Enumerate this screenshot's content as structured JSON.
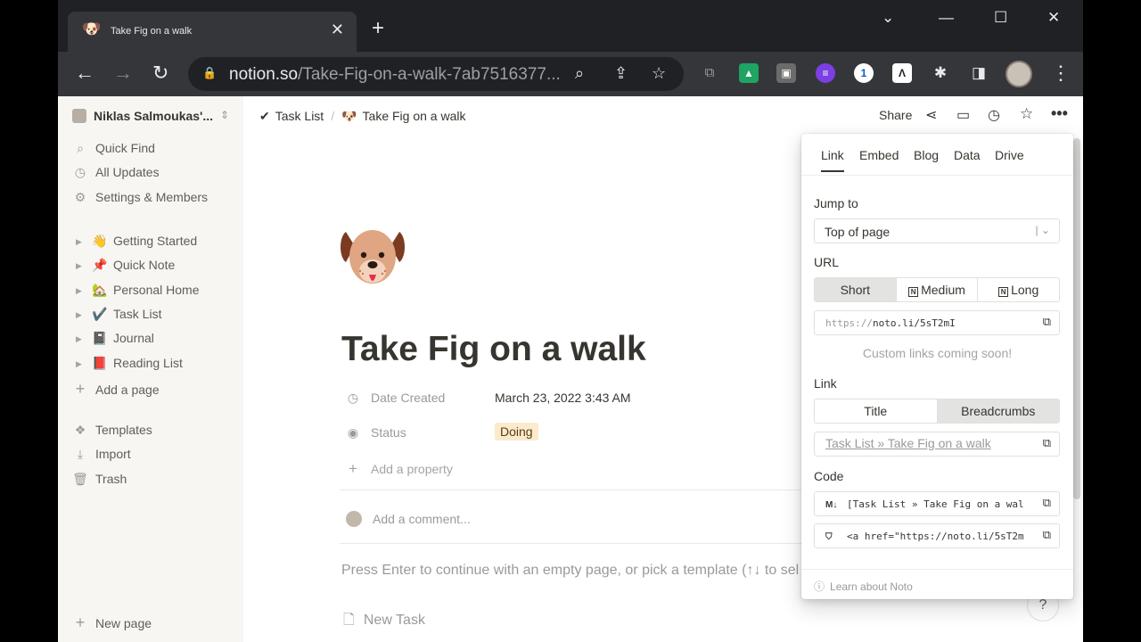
{
  "browser": {
    "tab_title": "Take Fig on a walk",
    "tab_favicon": "🐶",
    "url_domain": "notion.so",
    "url_rest": "/Take-Fig-on-a-walk-7ab7516377..."
  },
  "sidebar": {
    "workspace": "Niklas Salmoukas'...",
    "actions": [
      {
        "label": "Quick Find",
        "icon": "⌕"
      },
      {
        "label": "All Updates",
        "icon": "◷"
      },
      {
        "label": "Settings & Members",
        "icon": "⚙"
      }
    ],
    "pages": [
      {
        "label": "Getting Started",
        "emoji": "👋"
      },
      {
        "label": "Quick Note",
        "emoji": "📌"
      },
      {
        "label": "Personal Home",
        "emoji": "🏡"
      },
      {
        "label": "Task List",
        "emoji": "✔️"
      },
      {
        "label": "Journal",
        "emoji": "📓"
      },
      {
        "label": "Reading List",
        "emoji": "📕"
      }
    ],
    "add_page": "Add a page",
    "bottom": [
      {
        "label": "Templates",
        "icon": "❖"
      },
      {
        "label": "Import",
        "icon": "⤓"
      },
      {
        "label": "Trash",
        "icon": "🗑"
      }
    ],
    "new_page": "New page"
  },
  "topbar": {
    "breadcrumb_parent": "Task List",
    "breadcrumb_parent_icon": "✔",
    "breadcrumb_current": "Take Fig on a walk",
    "breadcrumb_current_icon": "🐶",
    "share": "Share"
  },
  "page": {
    "title": "Take Fig on a walk",
    "props": {
      "date_label": "Date Created",
      "date_value": "March 23, 2022 3:43 AM",
      "status_label": "Status",
      "status_value": "Doing",
      "status_color": "#fbeacc",
      "add_property": "Add a property"
    },
    "comment_placeholder": "Add a comment...",
    "hint": "Press Enter to continue with an empty page, or pick a template (↑↓ to sel",
    "new_task": "New Task"
  },
  "popover": {
    "tabs": [
      "Link",
      "Embed",
      "Blog",
      "Data",
      "Drive"
    ],
    "jump_label": "Jump to",
    "jump_value": "Top of page",
    "url_label": "URL",
    "url_options": [
      "Short",
      "Medium",
      "Long"
    ],
    "url_value": "https://noto.li/5sT2mI",
    "url_value_prefix": "https://",
    "url_value_rest": "noto.li/5sT2mI",
    "custom_note": "Custom links coming soon!",
    "link_label": "Link",
    "link_options": [
      "Title",
      "Breadcrumbs"
    ],
    "link_value": "Task List » Take Fig on a walk",
    "code_label": "Code",
    "code_markdown": "[Task List » Take Fig on a wal",
    "code_html": "<a href=\"https://noto.li/5sT2m",
    "learn": "Learn about Noto"
  }
}
